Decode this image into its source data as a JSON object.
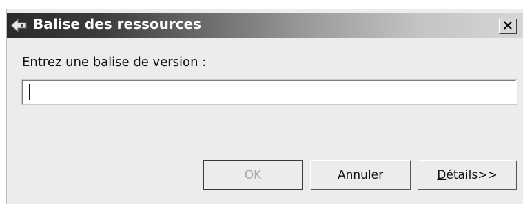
{
  "dialog": {
    "title": "Balise des ressources",
    "close_label": "X",
    "prompt": "Entrez une balise de version :",
    "input_value": ""
  },
  "buttons": {
    "ok_label": "OK",
    "cancel_label": "Annuler",
    "details_mnemonic": "D",
    "details_rest": "étails>>"
  },
  "icons": {
    "app_icon": "eclipse-team-icon",
    "close_icon": "close-icon"
  }
}
